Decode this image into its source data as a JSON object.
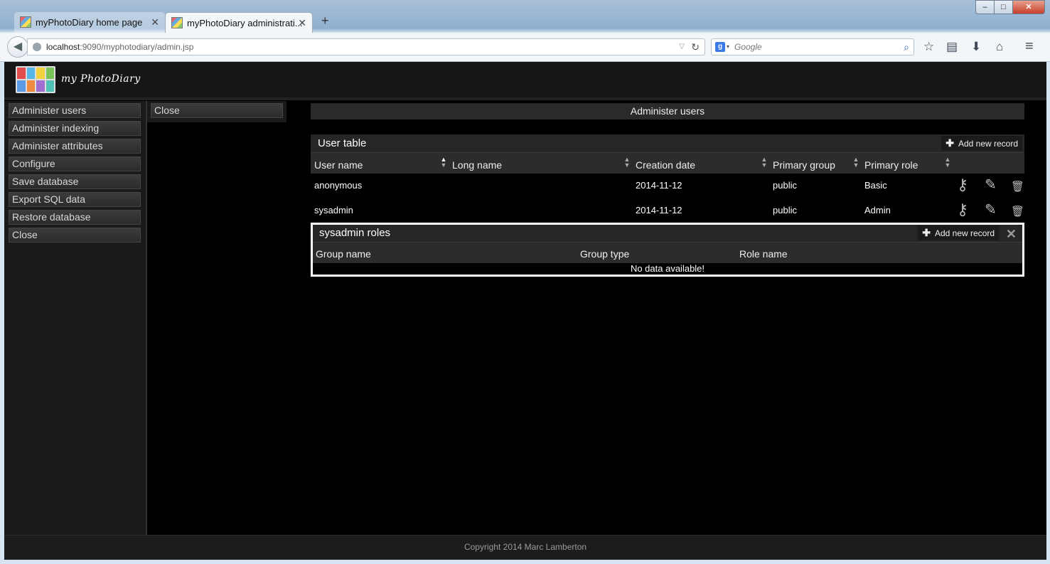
{
  "browser": {
    "tabs": [
      {
        "title": "myPhotoDiary home page"
      },
      {
        "title": "myPhotoDiary administrati..."
      }
    ],
    "url": {
      "host": "localhost",
      "rest": ":9090/myphotodiary/admin.jsp"
    },
    "search_placeholder": "Google",
    "search_engine_letter": "g",
    "window_controls": {
      "minimize": "‒",
      "maximize": "□",
      "close": "✕"
    },
    "icons": [
      "back-arrow-icon",
      "globe-icon",
      "reload-icon",
      "star-icon",
      "bookmarks-icon",
      "download-icon",
      "home-icon",
      "hamburger-menu-icon"
    ]
  },
  "site": {
    "logo_text": "my PhotoDiary",
    "logo_tile_colors": [
      "#e34c4c",
      "#57b5e8",
      "#f3d23f",
      "#7ac35b",
      "#5a9be6",
      "#ef8a3e",
      "#a06fd0",
      "#4fc1b6"
    ]
  },
  "menu": {
    "items": [
      "Administer users",
      "Administer indexing",
      "Administer attributes",
      "Configure",
      "Save database",
      "Export SQL data",
      "Restore database",
      "Close"
    ]
  },
  "submenu": {
    "close": "Close"
  },
  "main": {
    "title": "Administer users",
    "user_table": {
      "title": "User table",
      "add_label": "Add new record",
      "columns": [
        "User name",
        "Long name",
        "Creation date",
        "Primary group",
        "Primary role"
      ],
      "rows": [
        {
          "user_name": "anonymous",
          "long_name": "",
          "creation_date": "2014-11-12",
          "primary_group": "public",
          "primary_role": "Basic"
        },
        {
          "user_name": "sysadmin",
          "long_name": "",
          "creation_date": "2014-11-12",
          "primary_group": "public",
          "primary_role": "Admin"
        }
      ]
    },
    "roles_table": {
      "title": "sysadmin roles",
      "add_label": "Add new record",
      "columns": [
        "Group name",
        "Group type",
        "Role name"
      ],
      "empty_text": "No data available!"
    }
  },
  "footer": {
    "text": "Copyright 2014 Marc Lamberton"
  }
}
